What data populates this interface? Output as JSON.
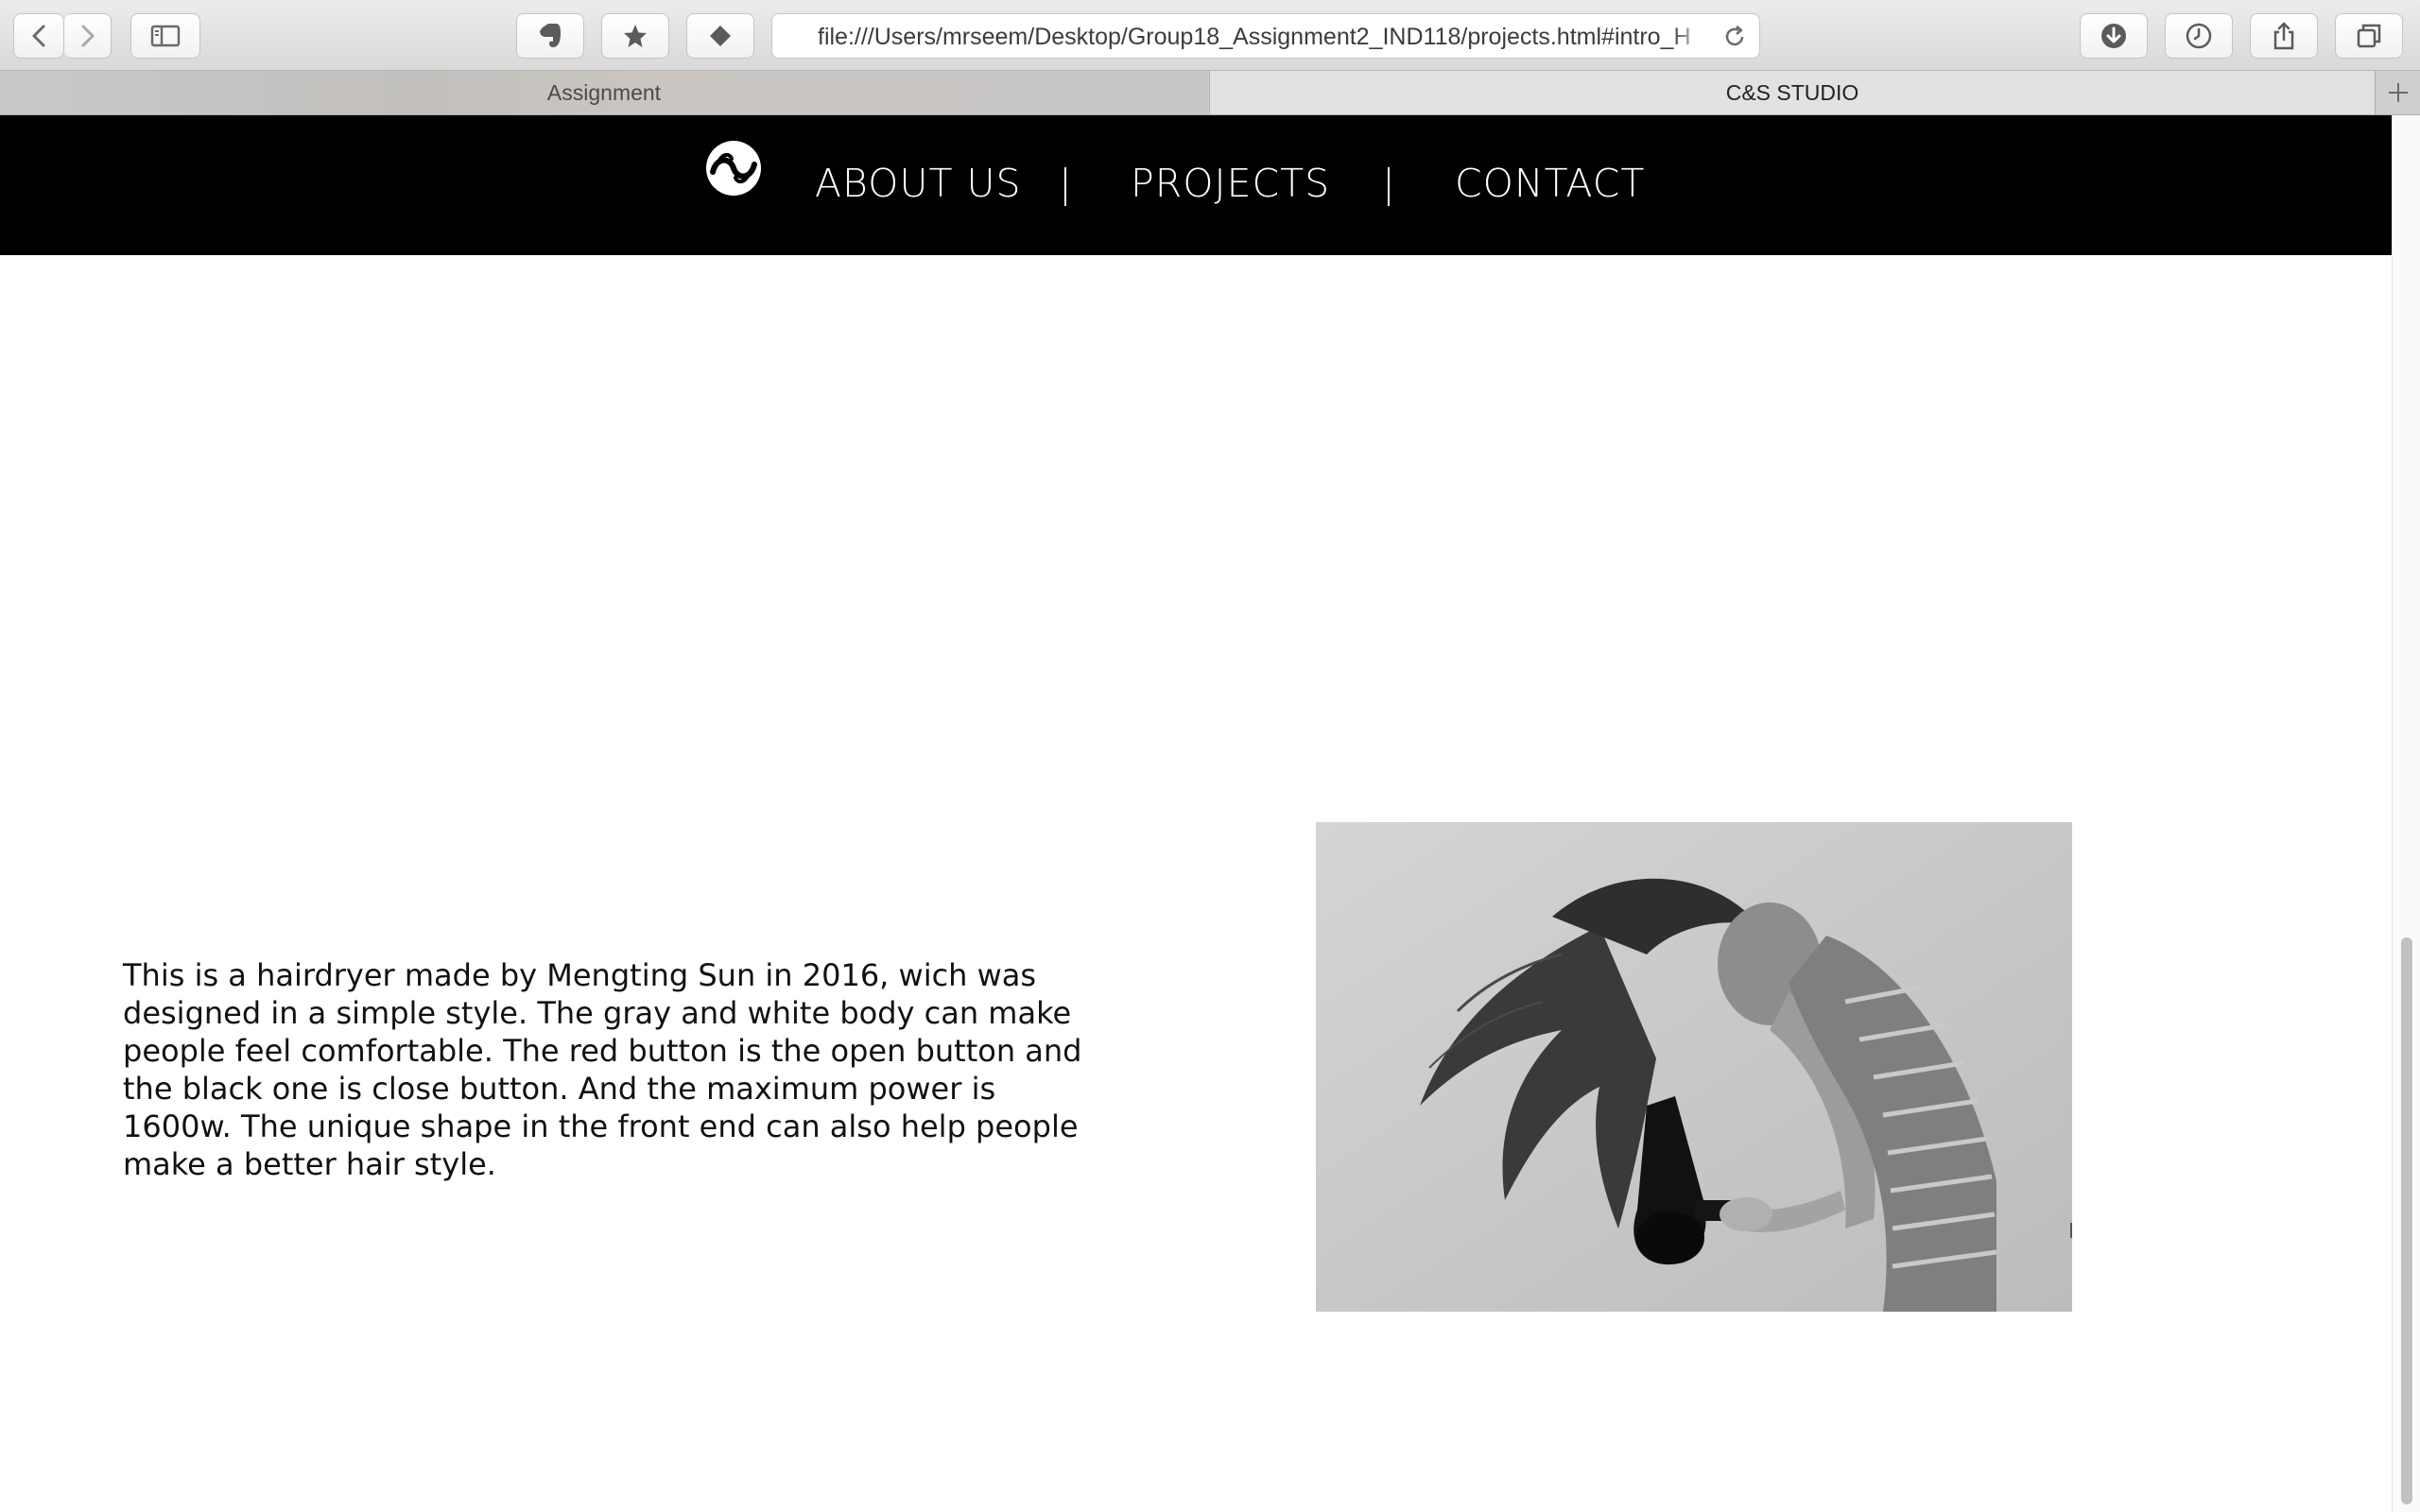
{
  "browser": {
    "url": "file:///Users/mrseem/Desktop/Group18_Assignment2_IND118/projects.html#intro_H",
    "tabs": [
      {
        "label": "Assignment",
        "active": false
      },
      {
        "label": "C&S STUDIO",
        "active": true
      }
    ],
    "icons": {
      "back": "chevron-left-icon",
      "forward": "chevron-right-icon",
      "sidebar": "sidebar-icon",
      "extension": "evernote-icon",
      "bookmark": "star-icon",
      "pocket": "diamond-icon",
      "reload": "reload-icon",
      "downloads": "download-icon",
      "history": "clock-icon",
      "share": "share-icon",
      "tabs": "tabs-overview-icon",
      "new_tab": "plus-icon"
    }
  },
  "site": {
    "nav": {
      "about": "ABOUT US",
      "separator": "|",
      "projects": "PROJECTS",
      "contact": "CONTACT"
    },
    "description": "This is a hairdryer made by Mengting Sun in 2016, wich was designed in a simple style. The gray and white body can make people feel comfortable. The red button is the open button and the black one is close button. And the maximum power is 1600w. The unique shape in the front end can also help people make a better hair style.",
    "colors": {
      "nav_background": "#000000",
      "nav_text": "#ffffff",
      "body_text": "#111111"
    }
  }
}
